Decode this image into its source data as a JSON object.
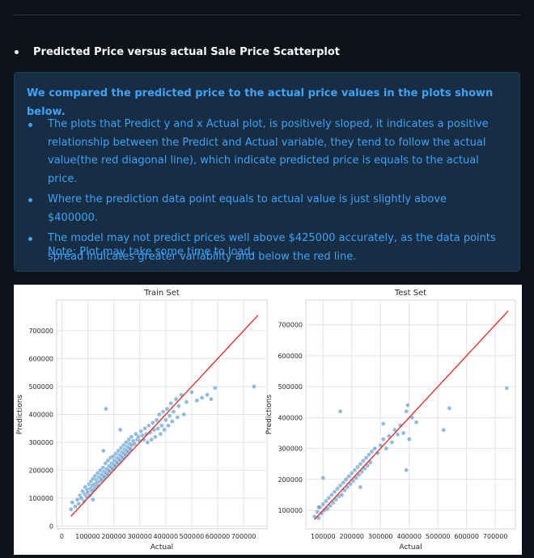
{
  "section": {
    "heading": "Predicted Price versus actual Sale Price Scatterplot"
  },
  "info": {
    "lead": "We compared the predicted price to the actual price values in the plots shown below.",
    "bullets": [
      "The plots that Predict y and x Actual plot, is positively sloped, it indicates a positive relationship between the Predict and Actual variable, they tend to follow the actual value(the red diagonal line), which indicate predicted price is equals to the actual price.",
      "Where the prediction data point equals to actual value is just slightly above $400000.",
      "The model may not predict prices well above $425000 accurately, as the data points spread indicates greater variability and below the red line."
    ],
    "note": "Note: Plot may take some time to load."
  },
  "colors": {
    "background": "#0e1117",
    "info_bg": "#172d43",
    "info_text": "#3ea3f7",
    "point": "#4c8fc6",
    "ref_line": "#e8231f"
  },
  "chart_data": [
    {
      "type": "scatter",
      "title": "Train Set",
      "xlabel": "Actual",
      "ylabel": "Predictions",
      "xlim": [
        -20000,
        790000
      ],
      "ylim": [
        -10000,
        810000
      ],
      "xticks": [
        0,
        100000,
        200000,
        300000,
        400000,
        500000,
        600000,
        700000
      ],
      "xtick_labels": [
        "0",
        "100000",
        "200000",
        "300000",
        "400000",
        "500000",
        "600000",
        "700000"
      ],
      "yticks": [
        0,
        100000,
        200000,
        300000,
        400000,
        500000,
        600000,
        700000
      ],
      "ytick_labels": [
        "0",
        "100000",
        "200000",
        "300000",
        "400000",
        "500000",
        "600000",
        "700000"
      ],
      "ref_line": [
        [
          35000,
          35000
        ],
        [
          755000,
          755000
        ]
      ],
      "grid": true,
      "points": [
        [
          35000,
          60000
        ],
        [
          40000,
          85000
        ],
        [
          52000,
          70000
        ],
        [
          60000,
          95000
        ],
        [
          65000,
          80000
        ],
        [
          70000,
          110000
        ],
        [
          75000,
          100000
        ],
        [
          80000,
          125000
        ],
        [
          85000,
          90000
        ],
        [
          88000,
          115000
        ],
        [
          90000,
          140000
        ],
        [
          95000,
          105000
        ],
        [
          98000,
          130000
        ],
        [
          100000,
          120000
        ],
        [
          105000,
          150000
        ],
        [
          108000,
          110000
        ],
        [
          110000,
          135000
        ],
        [
          112000,
          160000
        ],
        [
          115000,
          125000
        ],
        [
          118000,
          145000
        ],
        [
          120000,
          170000
        ],
        [
          122000,
          130000
        ],
        [
          125000,
          150000
        ],
        [
          128000,
          180000
        ],
        [
          130000,
          140000
        ],
        [
          132000,
          165000
        ],
        [
          135000,
          155000
        ],
        [
          138000,
          190000
        ],
        [
          140000,
          145000
        ],
        [
          142000,
          175000
        ],
        [
          145000,
          160000
        ],
        [
          148000,
          200000
        ],
        [
          150000,
          170000
        ],
        [
          152000,
          185000
        ],
        [
          155000,
          165000
        ],
        [
          158000,
          210000
        ],
        [
          160000,
          180000
        ],
        [
          162000,
          195000
        ],
        [
          165000,
          175000
        ],
        [
          168000,
          225000
        ],
        [
          170000,
          190000
        ],
        [
          172000,
          205000
        ],
        [
          175000,
          185000
        ],
        [
          178000,
          235000
        ],
        [
          180000,
          200000
        ],
        [
          182000,
          215000
        ],
        [
          185000,
          195000
        ],
        [
          188000,
          245000
        ],
        [
          190000,
          210000
        ],
        [
          192000,
          225000
        ],
        [
          195000,
          205000
        ],
        [
          198000,
          250000
        ],
        [
          200000,
          220000
        ],
        [
          202000,
          235000
        ],
        [
          205000,
          215000
        ],
        [
          208000,
          260000
        ],
        [
          210000,
          230000
        ],
        [
          212000,
          245000
        ],
        [
          215000,
          225000
        ],
        [
          218000,
          270000
        ],
        [
          220000,
          240000
        ],
        [
          222000,
          255000
        ],
        [
          225000,
          235000
        ],
        [
          228000,
          280000
        ],
        [
          230000,
          250000
        ],
        [
          232000,
          265000
        ],
        [
          235000,
          245000
        ],
        [
          238000,
          290000
        ],
        [
          240000,
          260000
        ],
        [
          242000,
          275000
        ],
        [
          245000,
          255000
        ],
        [
          248000,
          300000
        ],
        [
          250000,
          270000
        ],
        [
          252000,
          285000
        ],
        [
          255000,
          265000
        ],
        [
          258000,
          310000
        ],
        [
          260000,
          280000
        ],
        [
          262000,
          295000
        ],
        [
          265000,
          275000
        ],
        [
          268000,
          320000
        ],
        [
          270000,
          290000
        ],
        [
          275000,
          305000
        ],
        [
          280000,
          295000
        ],
        [
          285000,
          330000
        ],
        [
          290000,
          310000
        ],
        [
          295000,
          320000
        ],
        [
          300000,
          305000
        ],
        [
          305000,
          340000
        ],
        [
          310000,
          325000
        ],
        [
          315000,
          310000
        ],
        [
          320000,
          350000
        ],
        [
          325000,
          330000
        ],
        [
          330000,
          300000
        ],
        [
          335000,
          360000
        ],
        [
          340000,
          335000
        ],
        [
          345000,
          310000
        ],
        [
          350000,
          370000
        ],
        [
          355000,
          345000
        ],
        [
          360000,
          320000
        ],
        [
          365000,
          380000
        ],
        [
          370000,
          350000
        ],
        [
          375000,
          400000
        ],
        [
          380000,
          330000
        ],
        [
          385000,
          360000
        ],
        [
          390000,
          410000
        ],
        [
          395000,
          345000
        ],
        [
          400000,
          380000
        ],
        [
          405000,
          420000
        ],
        [
          410000,
          360000
        ],
        [
          415000,
          395000
        ],
        [
          420000,
          440000
        ],
        [
          425000,
          375000
        ],
        [
          430000,
          410000
        ],
        [
          440000,
          455000
        ],
        [
          445000,
          390000
        ],
        [
          450000,
          430000
        ],
        [
          460000,
          470000
        ],
        [
          470000,
          400000
        ],
        [
          480000,
          445000
        ],
        [
          500000,
          480000
        ],
        [
          520000,
          450000
        ],
        [
          540000,
          460000
        ],
        [
          560000,
          470000
        ],
        [
          575000,
          455000
        ],
        [
          590000,
          495000
        ],
        [
          740000,
          500000
        ],
        [
          170000,
          420000
        ],
        [
          160000,
          270000
        ],
        [
          225000,
          345000
        ],
        [
          120000,
          95000
        ]
      ]
    },
    {
      "type": "scatter",
      "title": "Test Set",
      "xlabel": "Actual",
      "ylabel": "Predictions",
      "xlim": [
        40000,
        770000
      ],
      "ylim": [
        40000,
        780000
      ],
      "xticks": [
        100000,
        200000,
        300000,
        400000,
        500000,
        600000,
        700000
      ],
      "xtick_labels": [
        "100000",
        "200000",
        "300000",
        "400000",
        "500000",
        "600000",
        "700000"
      ],
      "yticks": [
        100000,
        200000,
        300000,
        400000,
        500000,
        600000,
        700000
      ],
      "ytick_labels": [
        "100000",
        "200000",
        "300000",
        "400000",
        "500000",
        "600000",
        "700000"
      ],
      "ref_line": [
        [
          70000,
          70000
        ],
        [
          745000,
          745000
        ]
      ],
      "grid": true,
      "points": [
        [
          70000,
          80000
        ],
        [
          80000,
          95000
        ],
        [
          85000,
          75000
        ],
        [
          90000,
          110000
        ],
        [
          95000,
          90000
        ],
        [
          100000,
          120000
        ],
        [
          105000,
          100000
        ],
        [
          110000,
          130000
        ],
        [
          115000,
          105000
        ],
        [
          120000,
          140000
        ],
        [
          125000,
          115000
        ],
        [
          130000,
          150000
        ],
        [
          135000,
          125000
        ],
        [
          140000,
          160000
        ],
        [
          145000,
          135000
        ],
        [
          150000,
          170000
        ],
        [
          155000,
          145000
        ],
        [
          160000,
          180000
        ],
        [
          165000,
          150000
        ],
        [
          170000,
          190000
        ],
        [
          175000,
          165000
        ],
        [
          180000,
          200000
        ],
        [
          185000,
          175000
        ],
        [
          190000,
          210000
        ],
        [
          195000,
          185000
        ],
        [
          200000,
          220000
        ],
        [
          205000,
          195000
        ],
        [
          210000,
          230000
        ],
        [
          215000,
          205000
        ],
        [
          220000,
          240000
        ],
        [
          225000,
          215000
        ],
        [
          230000,
          250000
        ],
        [
          235000,
          225000
        ],
        [
          240000,
          260000
        ],
        [
          245000,
          235000
        ],
        [
          250000,
          270000
        ],
        [
          255000,
          245000
        ],
        [
          260000,
          280000
        ],
        [
          265000,
          255000
        ],
        [
          270000,
          290000
        ],
        [
          280000,
          300000
        ],
        [
          290000,
          285000
        ],
        [
          300000,
          310000
        ],
        [
          310000,
          330000
        ],
        [
          320000,
          300000
        ],
        [
          330000,
          340000
        ],
        [
          340000,
          320000
        ],
        [
          350000,
          360000
        ],
        [
          360000,
          345000
        ],
        [
          370000,
          375000
        ],
        [
          380000,
          350000
        ],
        [
          390000,
          420000
        ],
        [
          395000,
          440000
        ],
        [
          400000,
          330000
        ],
        [
          410000,
          400000
        ],
        [
          425000,
          385000
        ],
        [
          390000,
          230000
        ],
        [
          160000,
          420000
        ],
        [
          520000,
          360000
        ],
        [
          540000,
          430000
        ],
        [
          740000,
          495000
        ],
        [
          100000,
          205000
        ],
        [
          310000,
          380000
        ],
        [
          85000,
          110000
        ],
        [
          230000,
          175000
        ]
      ]
    }
  ]
}
